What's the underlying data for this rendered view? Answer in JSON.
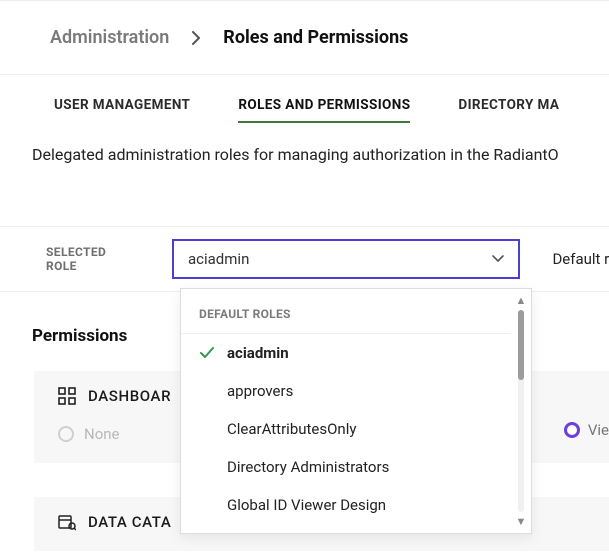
{
  "breadcrumb": {
    "parent": "Administration",
    "current": "Roles and Permissions"
  },
  "tabs": {
    "user_mgmt": "USER MANAGEMENT",
    "roles": "ROLES AND PERMISSIONS",
    "directory": "DIRECTORY MA"
  },
  "description": "Delegated administration roles for managing authorization in the RadiantO",
  "selected_role_label": "SELECTED ROLE",
  "selected_role_value": "aciadmin",
  "default_link": "Default r",
  "dropdown": {
    "heading": "DEFAULT ROLES",
    "items": [
      {
        "label": "aciadmin",
        "selected": true
      },
      {
        "label": "approvers",
        "selected": false
      },
      {
        "label": "ClearAttributesOnly",
        "selected": false
      },
      {
        "label": "Directory Administrators",
        "selected": false
      },
      {
        "label": "Global ID Viewer Design",
        "selected": false
      }
    ]
  },
  "permissions_title": "Permissions",
  "card_dashboard": "DASHBOAR",
  "card_none": "None",
  "card_vie": "Vie",
  "card_data": "DATA CATA"
}
